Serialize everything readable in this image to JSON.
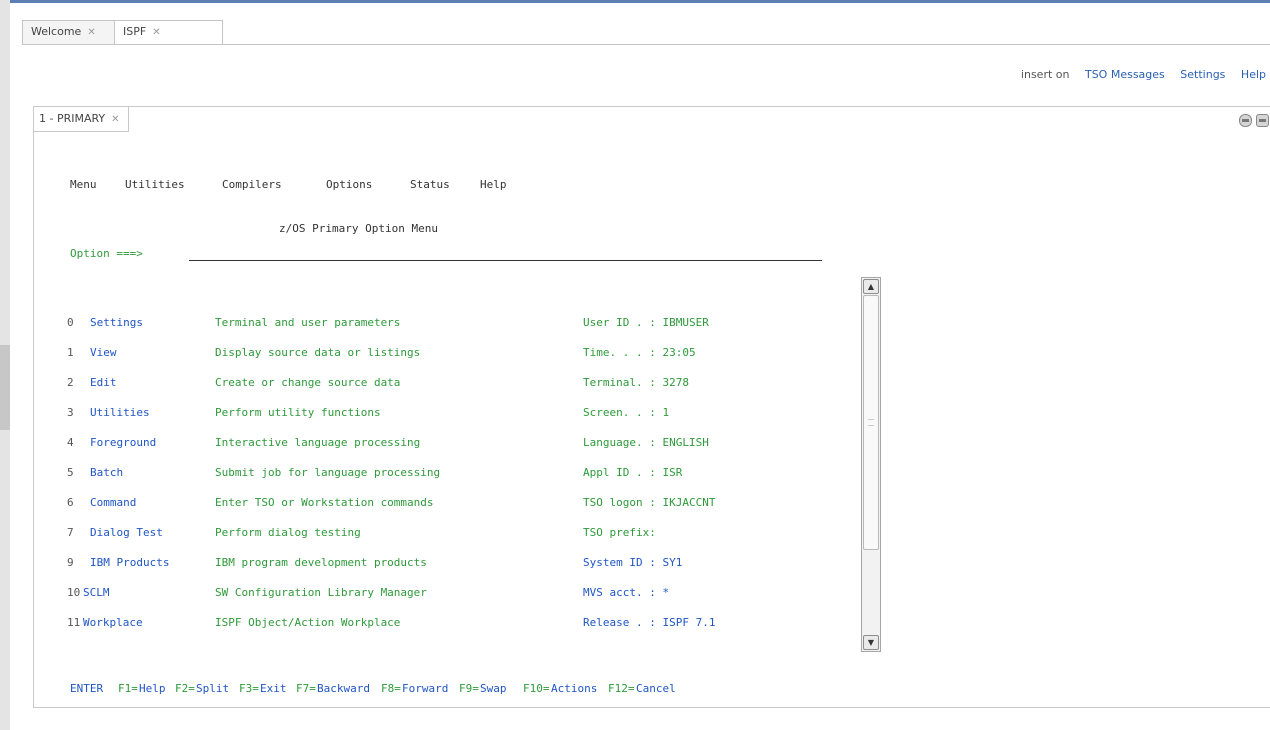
{
  "tabs": [
    {
      "label": "Welcome",
      "close": "✕"
    },
    {
      "label": "ISPF",
      "close": "✕"
    }
  ],
  "toolbar": {
    "insert": "insert on",
    "tso_messages": "TSO Messages",
    "settings": "Settings",
    "help": "Help"
  },
  "panel_tab": {
    "label": "1 - PRIMARY",
    "close": "✕"
  },
  "menu_bar": [
    "Menu",
    "Utilities",
    "Compilers",
    "Options",
    "Status",
    "Help"
  ],
  "screen_title": "z/OS Primary Option Menu",
  "option_prompt": "Option ===>",
  "options": [
    {
      "num": "0",
      "name": "Settings",
      "desc": "Terminal and user parameters",
      "info": "User ID . : IBMUSER"
    },
    {
      "num": "1",
      "name": "View",
      "desc": "Display source data or listings",
      "info": "Time. . . : 23:05"
    },
    {
      "num": "2",
      "name": "Edit",
      "desc": "Create or change source data",
      "info": "Terminal. : 3278"
    },
    {
      "num": "3",
      "name": "Utilities",
      "desc": "Perform utility functions",
      "info": "Screen. . : 1"
    },
    {
      "num": "4",
      "name": "Foreground",
      "desc": "Interactive language processing",
      "info": "Language. : ENGLISH"
    },
    {
      "num": "5",
      "name": "Batch",
      "desc": "Submit job for language processing",
      "info": "Appl ID . : ISR"
    },
    {
      "num": "6",
      "name": "Command",
      "desc": "Enter TSO or Workstation commands",
      "info": "TSO logon : IKJACCNT"
    },
    {
      "num": "7",
      "name": "Dialog Test",
      "desc": "Perform dialog testing",
      "info": "TSO prefix:"
    },
    {
      "num": "9",
      "name": "IBM Products",
      "desc": "IBM program development products",
      "info": "System ID : SY1"
    },
    {
      "num": "10",
      "name": "SCLM",
      "desc": "SW Configuration Library Manager",
      "info": "MVS acct. : *"
    },
    {
      "num": "11",
      "name": "Workplace",
      "desc": "ISPF Object/Action Workplace",
      "info": "Release . : ISPF 7.1"
    }
  ],
  "pf_keys": [
    {
      "key": "ENTER",
      "label": ""
    },
    {
      "key": "F1=",
      "label": "Help"
    },
    {
      "key": "F2=",
      "label": "Split"
    },
    {
      "key": "F3=",
      "label": "Exit"
    },
    {
      "key": "F7=",
      "label": "Backward"
    },
    {
      "key": "F8=",
      "label": "Forward"
    },
    {
      "key": "F9=",
      "label": "Swap"
    },
    {
      "key": "F10=",
      "label": "Actions"
    },
    {
      "key": "F12=",
      "label": "Cancel"
    }
  ],
  "scroll": {
    "up": "▲",
    "down": "▼"
  },
  "colors": {
    "field_green": "#2e9a3a",
    "link_blue": "#1f55c4",
    "accent": "#5b7fb4"
  }
}
